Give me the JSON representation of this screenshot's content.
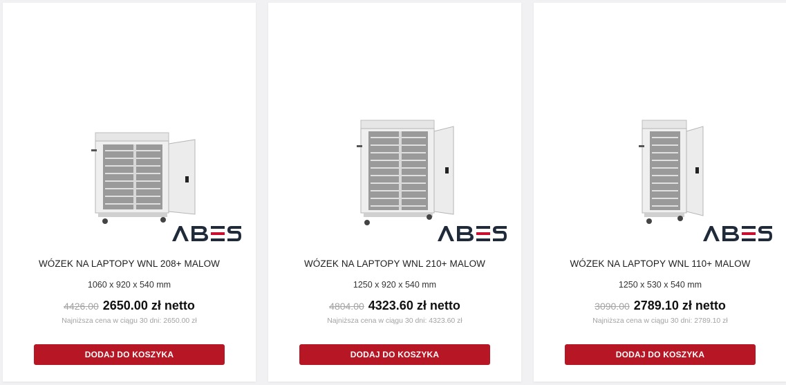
{
  "colors": {
    "accent": "#b71724",
    "logo_dark": "#1f2a3a",
    "logo_red": "#c8102e",
    "old_price": "#a3a3a3"
  },
  "products": [
    {
      "title": "WÓZEK NA LAPTOPY WNL 208+ MALOW",
      "dimensions": "1060 x 920 x 540 mm",
      "old_price": "4426.00",
      "new_price": "2650.00 zł netto",
      "lowest_price": "Najniższa cena w ciągu 30 dni: 2650.00 zł",
      "button": "DODAJ DO KOSZYKA",
      "brand": "ABES"
    },
    {
      "title": "WÓZEK NA LAPTOPY WNL 210+ MALOW",
      "dimensions": "1250 x 920 x 540 mm",
      "old_price": "4804.00",
      "new_price": "4323.60 zł netto",
      "lowest_price": "Najniższa cena w ciągu 30 dni: 4323.60 zł",
      "button": "DODAJ DO KOSZYKA",
      "brand": "ABES"
    },
    {
      "title": "WÓZEK NA LAPTOPY WNL 110+ MALOW",
      "dimensions": "1250 x 530 x 540 mm",
      "old_price": "3090.00",
      "new_price": "2789.10 zł netto",
      "lowest_price": "Najniższa cena w ciągu 30 dni: 2789.10 zł",
      "button": "DODAJ DO KOSZYKA",
      "brand": "ABES"
    }
  ]
}
